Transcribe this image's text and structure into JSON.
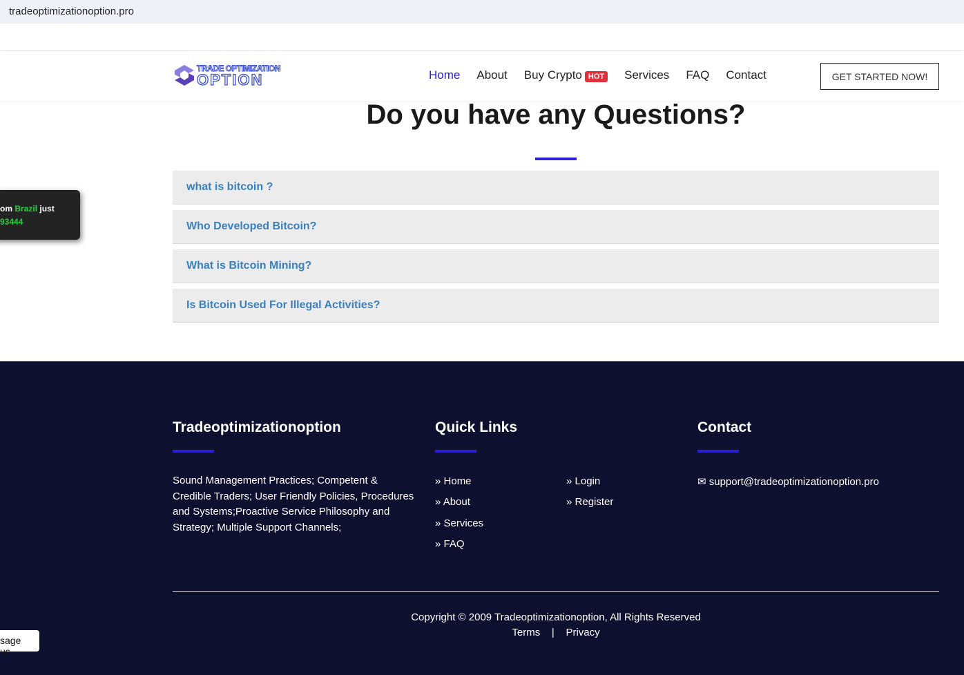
{
  "browser": {
    "url": "tradeoptimizationoption.pro"
  },
  "header": {
    "logo_line1": "TRADE OPTIMIZATION",
    "logo_line2": "OPTION",
    "nav": [
      "Home",
      "About",
      "Buy Crypto",
      "Services",
      "FAQ",
      "Contact"
    ],
    "hot": "HOT",
    "cta": "GET STARTED NOW!"
  },
  "main": {
    "title": "Do you have any Questions?",
    "faqs": [
      "what is bitcoin ?",
      "Who Developed Bitcoin?",
      "What is Bitcoin Mining?",
      "Is Bitcoin Used For Illegal Activities?"
    ]
  },
  "toast": {
    "pre": "om ",
    "country": "Brazil",
    "post": " just",
    "amount": "93444"
  },
  "footer": {
    "brand": "Tradeoptimizationoption",
    "about": "Sound Management Practices; Competent & Credible Traders; User Friendly Policies, Procedures and Systems;Proactive Service Philosophy and Strategy; Multiple Support Channels;",
    "quick_title": "Quick Links",
    "links1": [
      "Home",
      "About",
      "Services",
      "FAQ"
    ],
    "links2": [
      "Login",
      "Register"
    ],
    "contact_title": "Contact",
    "email": "support@tradeoptimizationoption.pro",
    "copyright": "Copyright © 2009 Tradeoptimizationoption, All Rights Reserved",
    "terms": "Terms",
    "sep": "|",
    "privacy": "Privacy"
  },
  "message": "sage us"
}
